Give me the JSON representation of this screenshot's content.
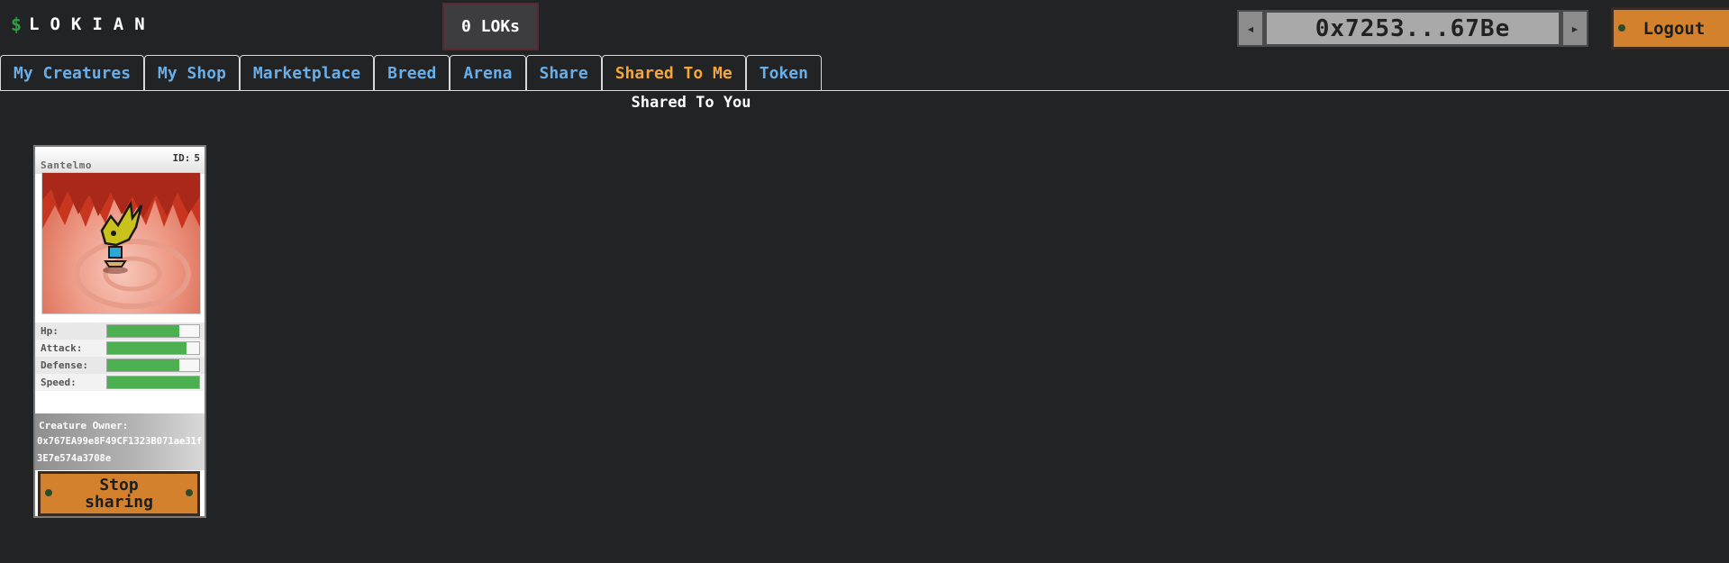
{
  "brand": {
    "icon": "$",
    "name": "LOKIAN"
  },
  "balance": {
    "label": "0 LOKs"
  },
  "wallet": {
    "address": "0x7253...67Be",
    "left_icon": "arrow-left-icon",
    "right_icon": "arrow-right-icon"
  },
  "logout": {
    "label": "Logout"
  },
  "tabs": [
    {
      "label": "My Creatures",
      "active": false
    },
    {
      "label": "My Shop",
      "active": false
    },
    {
      "label": "Marketplace",
      "active": false
    },
    {
      "label": "Breed",
      "active": false
    },
    {
      "label": "Arena",
      "active": false
    },
    {
      "label": "Share",
      "active": false
    },
    {
      "label": "Shared To Me",
      "active": true
    },
    {
      "label": "Token",
      "active": false
    }
  ],
  "section_title": "Shared To You",
  "creature": {
    "name": "Santelmo",
    "id_label": "ID:",
    "id_value": "5",
    "stats": [
      {
        "label": "Hp:",
        "value": 0.78
      },
      {
        "label": "Attack:",
        "value": 0.86
      },
      {
        "label": "Defense:",
        "value": 0.78
      },
      {
        "label": "Speed:",
        "value": 1.0
      }
    ],
    "owner_label": "Creature Owner:",
    "owner_address": "0x767EA99e8F49CF1323B071ae31f3E7e574a3708e",
    "stop_sharing_label": "Stop sharing"
  },
  "colors": {
    "background": "#222325",
    "tab_text": "#6aaee8",
    "tab_active_text": "#f3a73a",
    "button_orange": "#d4812e",
    "stat_fill": "#4caf50"
  }
}
